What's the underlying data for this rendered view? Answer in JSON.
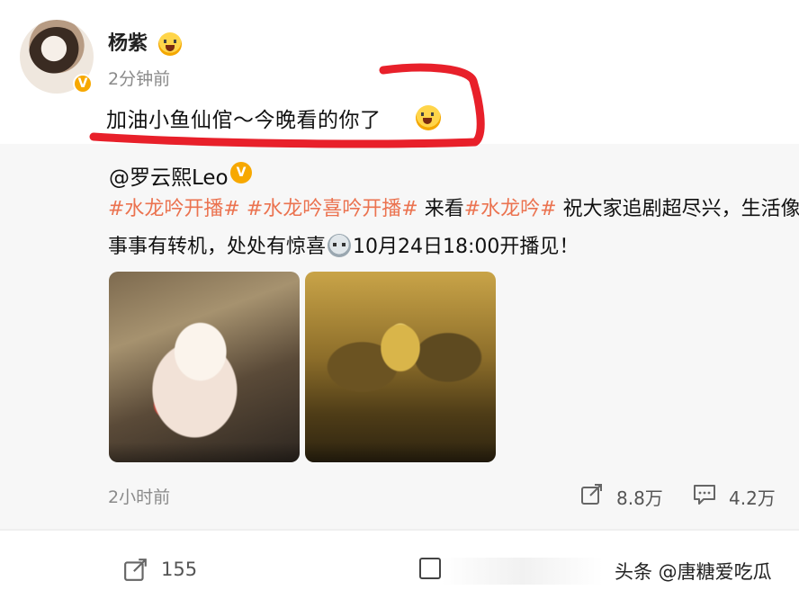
{
  "post": {
    "author": "杨紫",
    "time": "2分钟前",
    "text": "加油小鱼仙倌～今晚看的你了",
    "verified_icon": "verified-v-icon",
    "verified_mark": "V"
  },
  "repost": {
    "author": "@罗云熙Leo",
    "verified_mark": "V",
    "line1": {
      "tag1": "#水龙吟开播#",
      "tag2": "#水龙吟喜吟开播#",
      "text1": " 来看",
      "tag3": "#水龙吟#",
      "text2": " 祝大家追剧超尽兴，生活像唐"
    },
    "line2": {
      "text1": "事事有转机，处处有惊喜",
      "text2": "10月24日18:00开播见！"
    },
    "time": "2小时前",
    "share_count": "8.8万",
    "comment_count": "4.2万"
  },
  "footer": {
    "share_count": "155",
    "watermark": "头条 @唐糖爱吃瓜"
  },
  "colors": {
    "tag": "#eb7350",
    "verified": "#f7a800",
    "marker": "#e8202a"
  }
}
